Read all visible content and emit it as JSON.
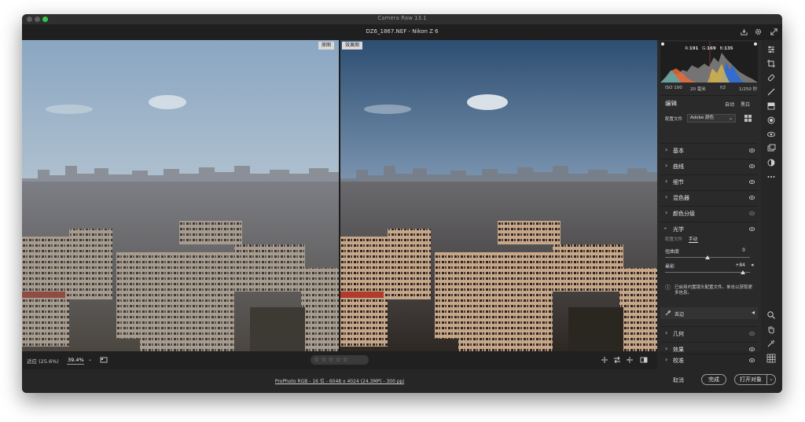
{
  "window": {
    "title": "Camera Raw 13.1"
  },
  "header": {
    "file_info": "DZ6_1867.NEF  -  Nikon Z 6"
  },
  "preview": {
    "before_label": "原图",
    "after_label": "效果图"
  },
  "bottom_bar": {
    "fit_label": "适应 (25.6%)",
    "zoom_value": "39.4%",
    "stars": "☆☆☆☆☆"
  },
  "footer": {
    "color_info": "ProPhoto RGB - 16 位 - 6048 x 4024 (24.3MP) - 300 ppi",
    "cancel_label": "取消",
    "done_label": "完成",
    "open_label": "打开对象"
  },
  "histogram": {
    "r_label": "R:",
    "r_value": "191",
    "g_label": "G:",
    "g_value": "169",
    "b_label": "B:",
    "b_value": "135"
  },
  "exif": {
    "iso": "ISO 100",
    "focal": "20 毫米",
    "aperture": "f/2",
    "shutter": "1/250 秒"
  },
  "edit": {
    "title": "编辑",
    "auto_label": "自动",
    "bw_label": "黑白",
    "profile_label": "配置文件",
    "profile_value": "Adobe 颜色"
  },
  "sections": [
    {
      "label": "基本",
      "expanded": false
    },
    {
      "label": "曲线",
      "expanded": false
    },
    {
      "label": "细节",
      "expanded": false
    },
    {
      "label": "混色器",
      "expanded": false
    },
    {
      "label": "颜色分级",
      "expanded": false
    },
    {
      "label": "光学",
      "expanded": true
    }
  ],
  "optics": {
    "tab_profile": "配置文件",
    "tab_manual": "手动",
    "distortion_label": "扭曲度",
    "distortion_value": "0",
    "distortion_level": 0.5,
    "vignette_label": "晕影",
    "vignette_value": "+84",
    "vignette_level": 0.92,
    "notice": "已启用内置镜头配置文件。单击以获取更多信息。",
    "remove_label": "去边"
  },
  "bottom_sections": [
    {
      "label": "几何"
    },
    {
      "label": "效果"
    },
    {
      "label": "校准"
    }
  ],
  "colors": {
    "window_bg": "#262626",
    "panel_bg": "#2a2a2a",
    "accent_text": "#e4e4e4",
    "traffic_close": "#5e5e5e",
    "traffic_min": "#5e5e5e",
    "traffic_max": "#34c84a"
  }
}
